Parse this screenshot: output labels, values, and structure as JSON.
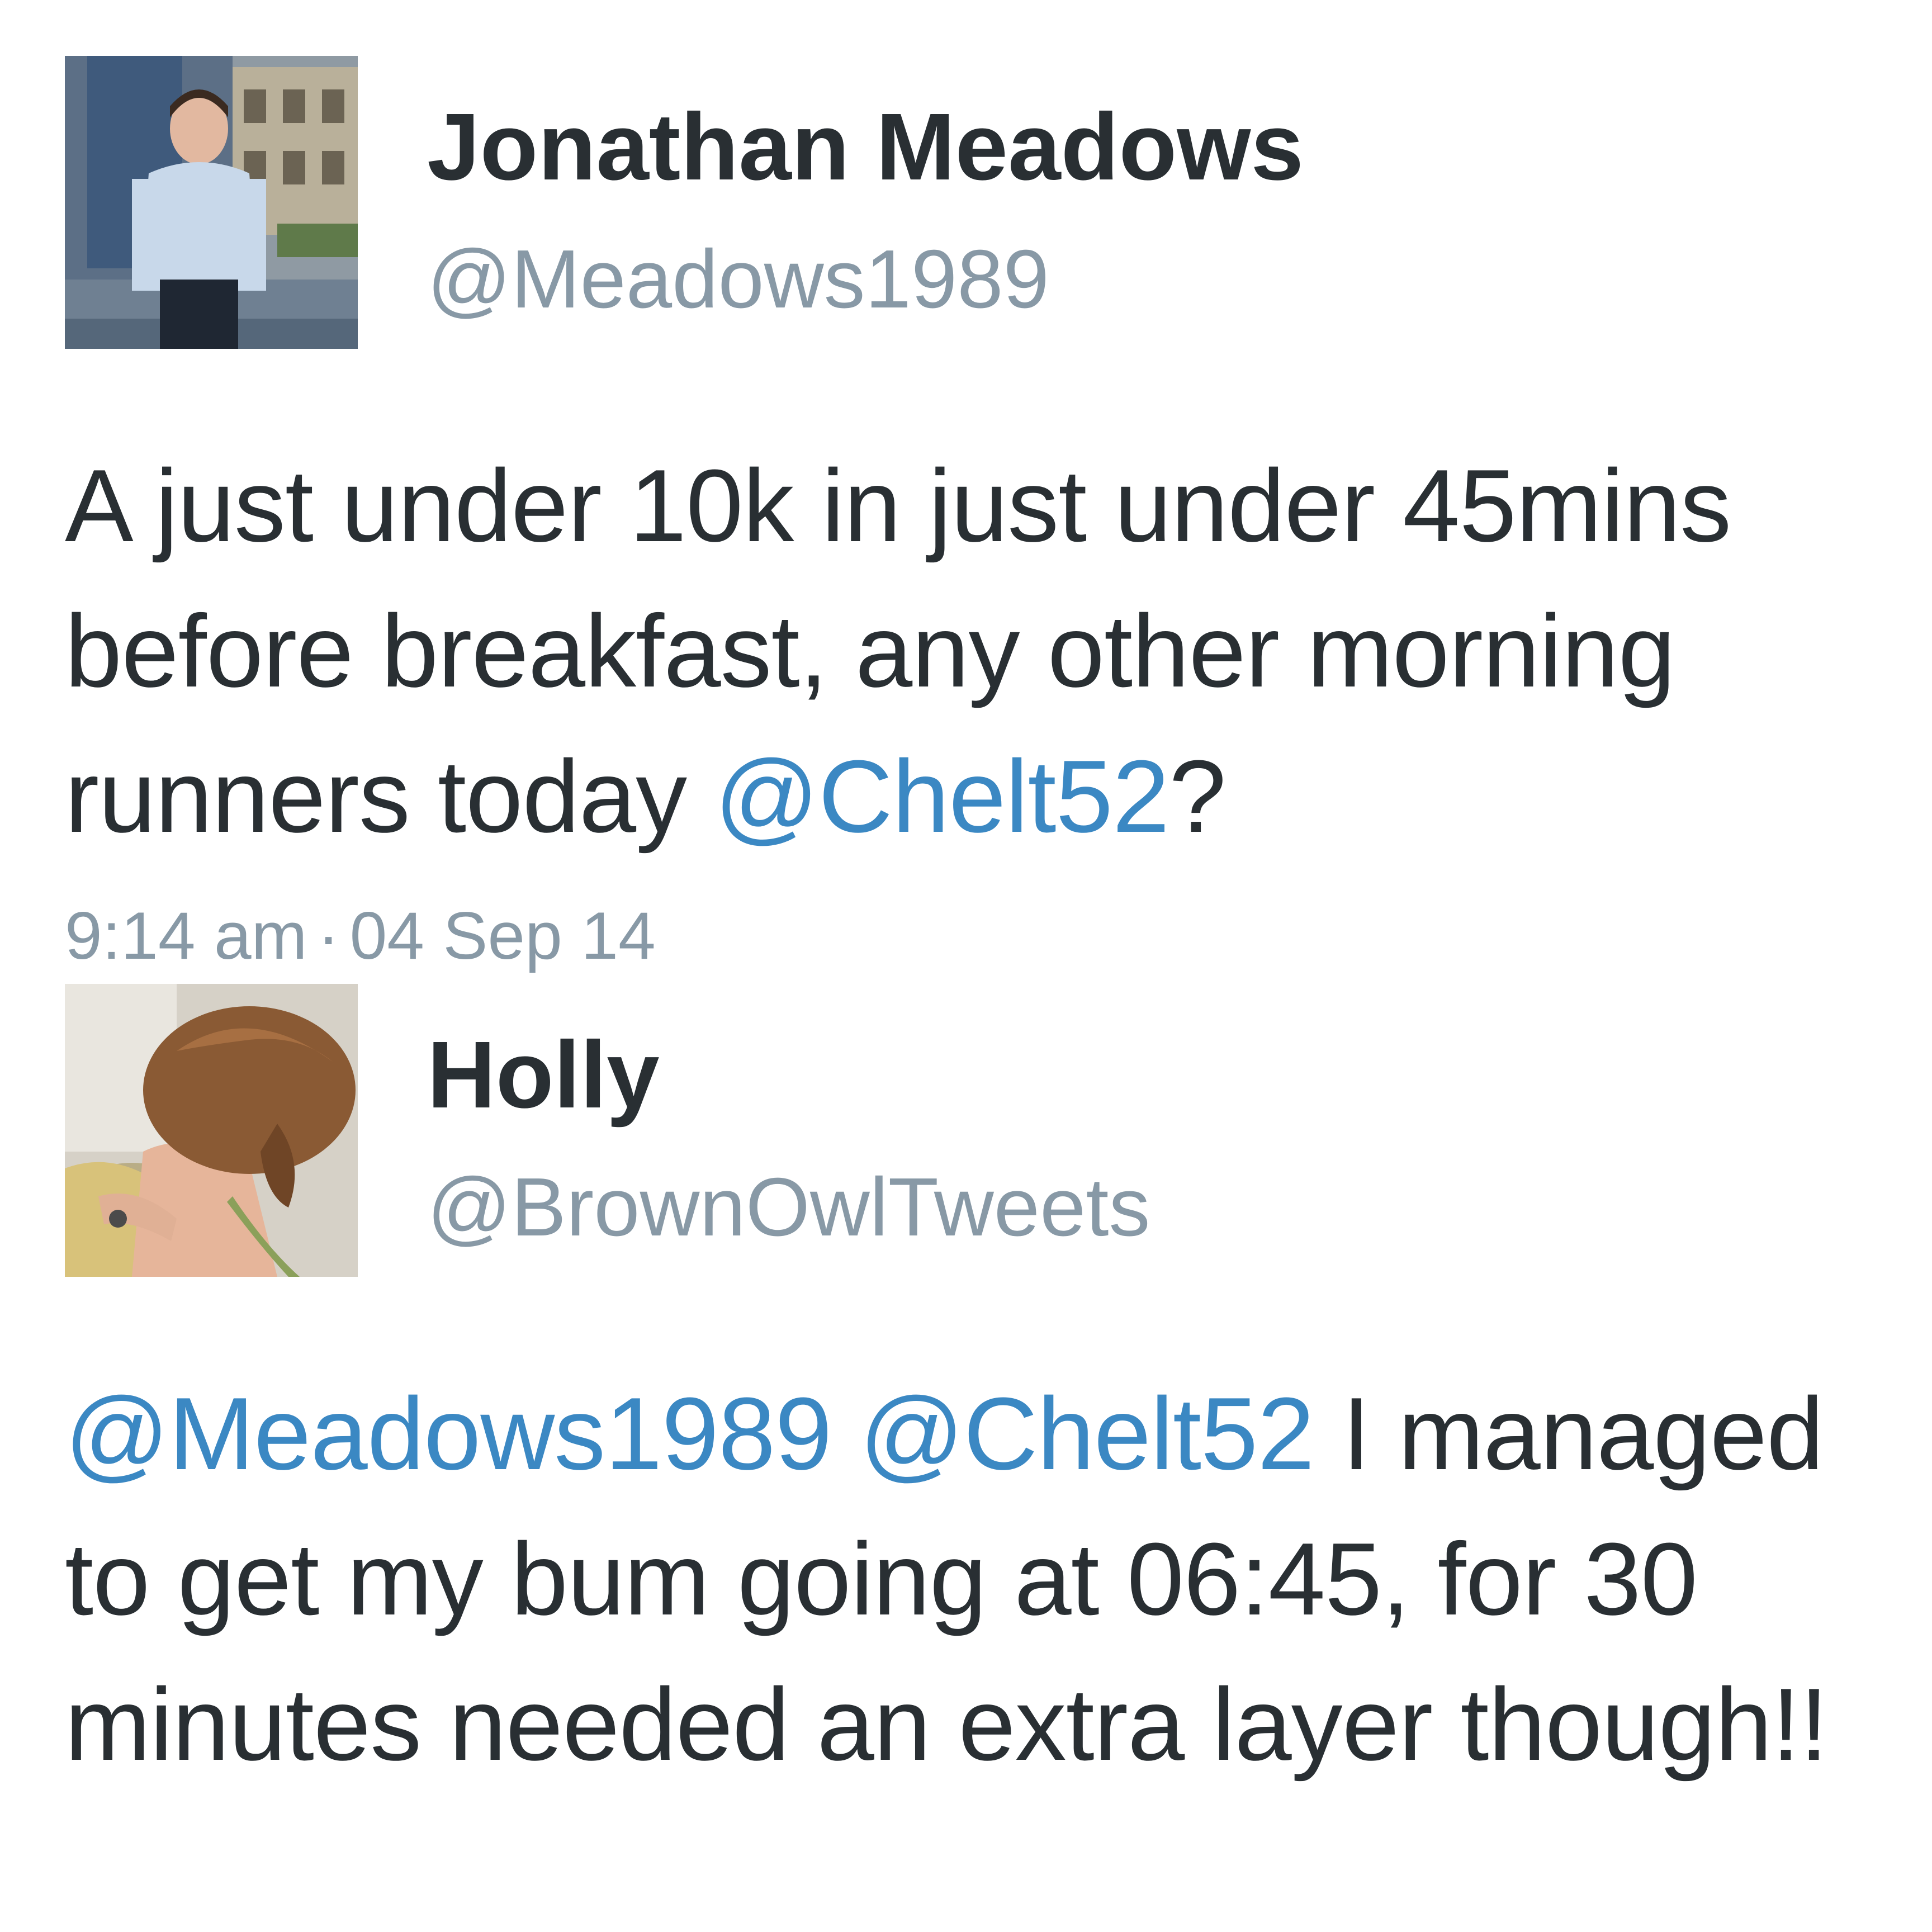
{
  "tweets": [
    {
      "author": {
        "display_name": "Jonathan Meadows",
        "handle": "@Meadows1989",
        "avatar_icon": "profile-photo-man-icon"
      },
      "text": {
        "part1": "A just under 10k in just under 45mins before breakfast, any other morning runners today ",
        "mention1": "@Chelt52",
        "part2": "?"
      },
      "time": "9:14 am",
      "separator": "·",
      "date": "04 Sep 14"
    },
    {
      "author": {
        "display_name": "Holly",
        "handle": "@BrownOwlTweets",
        "avatar_icon": "profile-photo-woman-icon"
      },
      "text": {
        "mention1": "@Meadows1989",
        "gap": " ",
        "mention2": "@Chelt52",
        "part1": " I managed to get my bum going at 06:45, for 30 minutes needed an extra layer though!!"
      }
    }
  ],
  "colors": {
    "text": "#292f33",
    "secondary": "#8899a6",
    "mention": "#3b88c3",
    "background": "#ffffff"
  }
}
